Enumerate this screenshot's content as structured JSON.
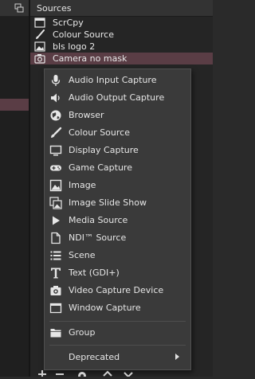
{
  "sources_dock": {
    "title": "Sources",
    "items": [
      {
        "label": "ScrCpy",
        "icon": "window-capture-icon",
        "selected": false
      },
      {
        "label": "Colour Source",
        "icon": "paint-brush-icon",
        "selected": false
      },
      {
        "label": "bls logo 2",
        "icon": "image-icon",
        "selected": false
      },
      {
        "label": "Camera no mask",
        "icon": "camera-icon",
        "selected": true
      }
    ]
  },
  "context_menu": {
    "items": [
      {
        "label": "Audio Input Capture",
        "icon": "microphone-icon"
      },
      {
        "label": "Audio Output Capture",
        "icon": "speaker-icon"
      },
      {
        "label": "Browser",
        "icon": "globe-icon"
      },
      {
        "label": "Colour Source",
        "icon": "paint-brush-icon"
      },
      {
        "label": "Display Capture",
        "icon": "monitor-icon"
      },
      {
        "label": "Game Capture",
        "icon": "gamepad-icon"
      },
      {
        "label": "Image",
        "icon": "image-icon"
      },
      {
        "label": "Image Slide Show",
        "icon": "slideshow-icon"
      },
      {
        "label": "Media Source",
        "icon": "play-icon"
      },
      {
        "label": "NDI™ Source",
        "icon": "file-icon"
      },
      {
        "label": "Scene",
        "icon": "list-icon"
      },
      {
        "label": "Text (GDI+)",
        "icon": "text-icon"
      },
      {
        "label": "Video Capture Device",
        "icon": "camera-icon"
      },
      {
        "label": "Window Capture",
        "icon": "window-icon"
      }
    ],
    "group_label": "Group",
    "deprecated_label": "Deprecated"
  },
  "colors": {
    "selection": "#5a3d45",
    "menu_background": "#3a3a3a",
    "dock_background": "#252525"
  }
}
